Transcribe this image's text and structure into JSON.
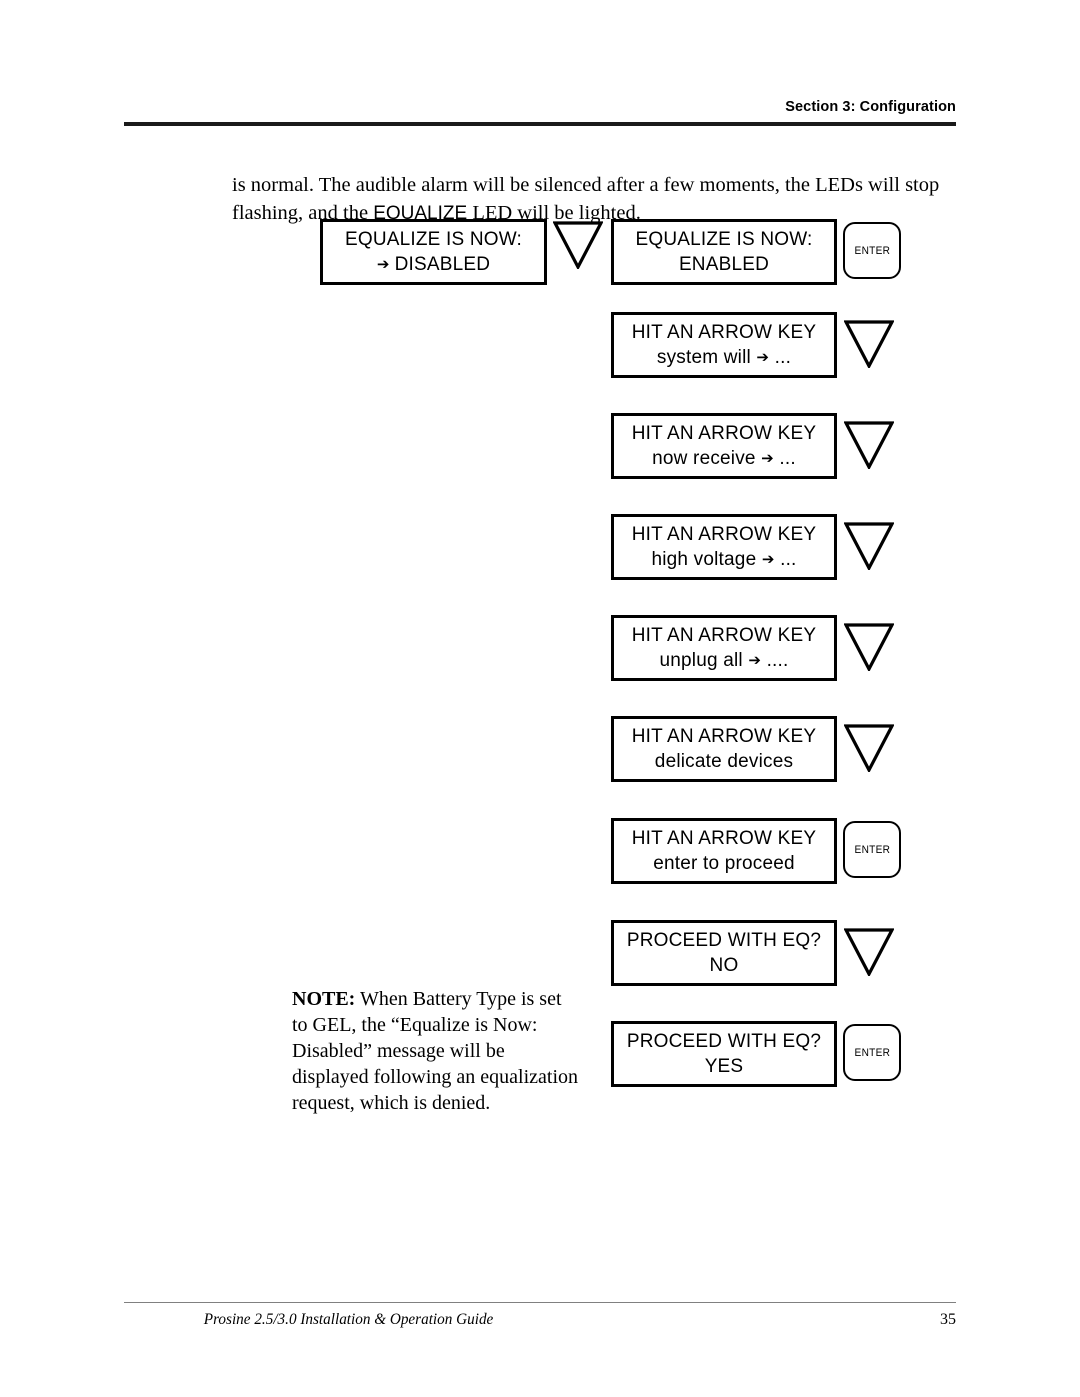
{
  "header": {
    "title": "Section 3: Configuration"
  },
  "body": {
    "intro_part1": "is normal. The audible alarm will be silenced after a few moments, the LEDs will stop flashing, and the ",
    "intro_emphasis": "EQUALIZE",
    "intro_part2": " LED will be lighted."
  },
  "note": {
    "label": "NOTE:",
    "text": " When Battery Type is set to GEL, the “Equalize is Now: Disabled” message will be displayed following an equalization request, which is denied."
  },
  "diagram": {
    "arrow_glyph": "➔",
    "left_column": [
      {
        "name": "equalize-disabled",
        "line1": "EQUALIZE IS NOW:",
        "line2_prefix": "➔ ",
        "line2": "DISABLED",
        "connector": "triangle-down"
      }
    ],
    "right_column": [
      {
        "name": "equalize-enabled",
        "line1": "EQUALIZE IS NOW:",
        "line2_prefix": "",
        "line2": "ENABLED",
        "connector": "enter-key"
      },
      {
        "name": "hit-arrow-system-will",
        "line1": "HIT AN ARROW KEY",
        "line2_prefix": "",
        "line2": "system will ➔ ...",
        "connector": "triangle-down"
      },
      {
        "name": "hit-arrow-now-receive",
        "line1": "HIT AN ARROW KEY",
        "line2_prefix": "",
        "line2": "now receive ➔ ...",
        "connector": "triangle-down"
      },
      {
        "name": "hit-arrow-high-voltage",
        "line1": "HIT AN ARROW KEY",
        "line2_prefix": "",
        "line2": "high voltage ➔ ...",
        "connector": "triangle-down"
      },
      {
        "name": "hit-arrow-unplug-all",
        "line1": "HIT AN ARROW KEY",
        "line2_prefix": "",
        "line2": "unplug all ➔ ....",
        "connector": "triangle-down"
      },
      {
        "name": "hit-arrow-delicate-devices",
        "line1": "HIT AN ARROW KEY",
        "line2_prefix": "",
        "line2": "delicate devices",
        "connector": "triangle-down"
      },
      {
        "name": "hit-arrow-enter-to-proceed",
        "line1": "HIT AN ARROW KEY",
        "line2_prefix": "",
        "line2": "enter to proceed",
        "connector": "enter-key"
      },
      {
        "name": "proceed-with-eq-no",
        "line1": "PROCEED WITH EQ?",
        "line2_prefix": "",
        "line2": "NO",
        "connector": "triangle-down"
      },
      {
        "name": "proceed-with-eq-yes",
        "line1": "PROCEED WITH EQ?",
        "line2_prefix": "",
        "line2": "YES",
        "connector": "enter-key"
      }
    ],
    "enter_key_label": "ENTER"
  },
  "footer": {
    "guide_title": "Prosine 2.5/3.0 Installation & Operation Guide",
    "page_number": "35"
  },
  "colors": {
    "ink": "#000000",
    "rule_header": "#1a1a1a",
    "rule_footer": "#808080",
    "page_background": "#ffffff"
  }
}
